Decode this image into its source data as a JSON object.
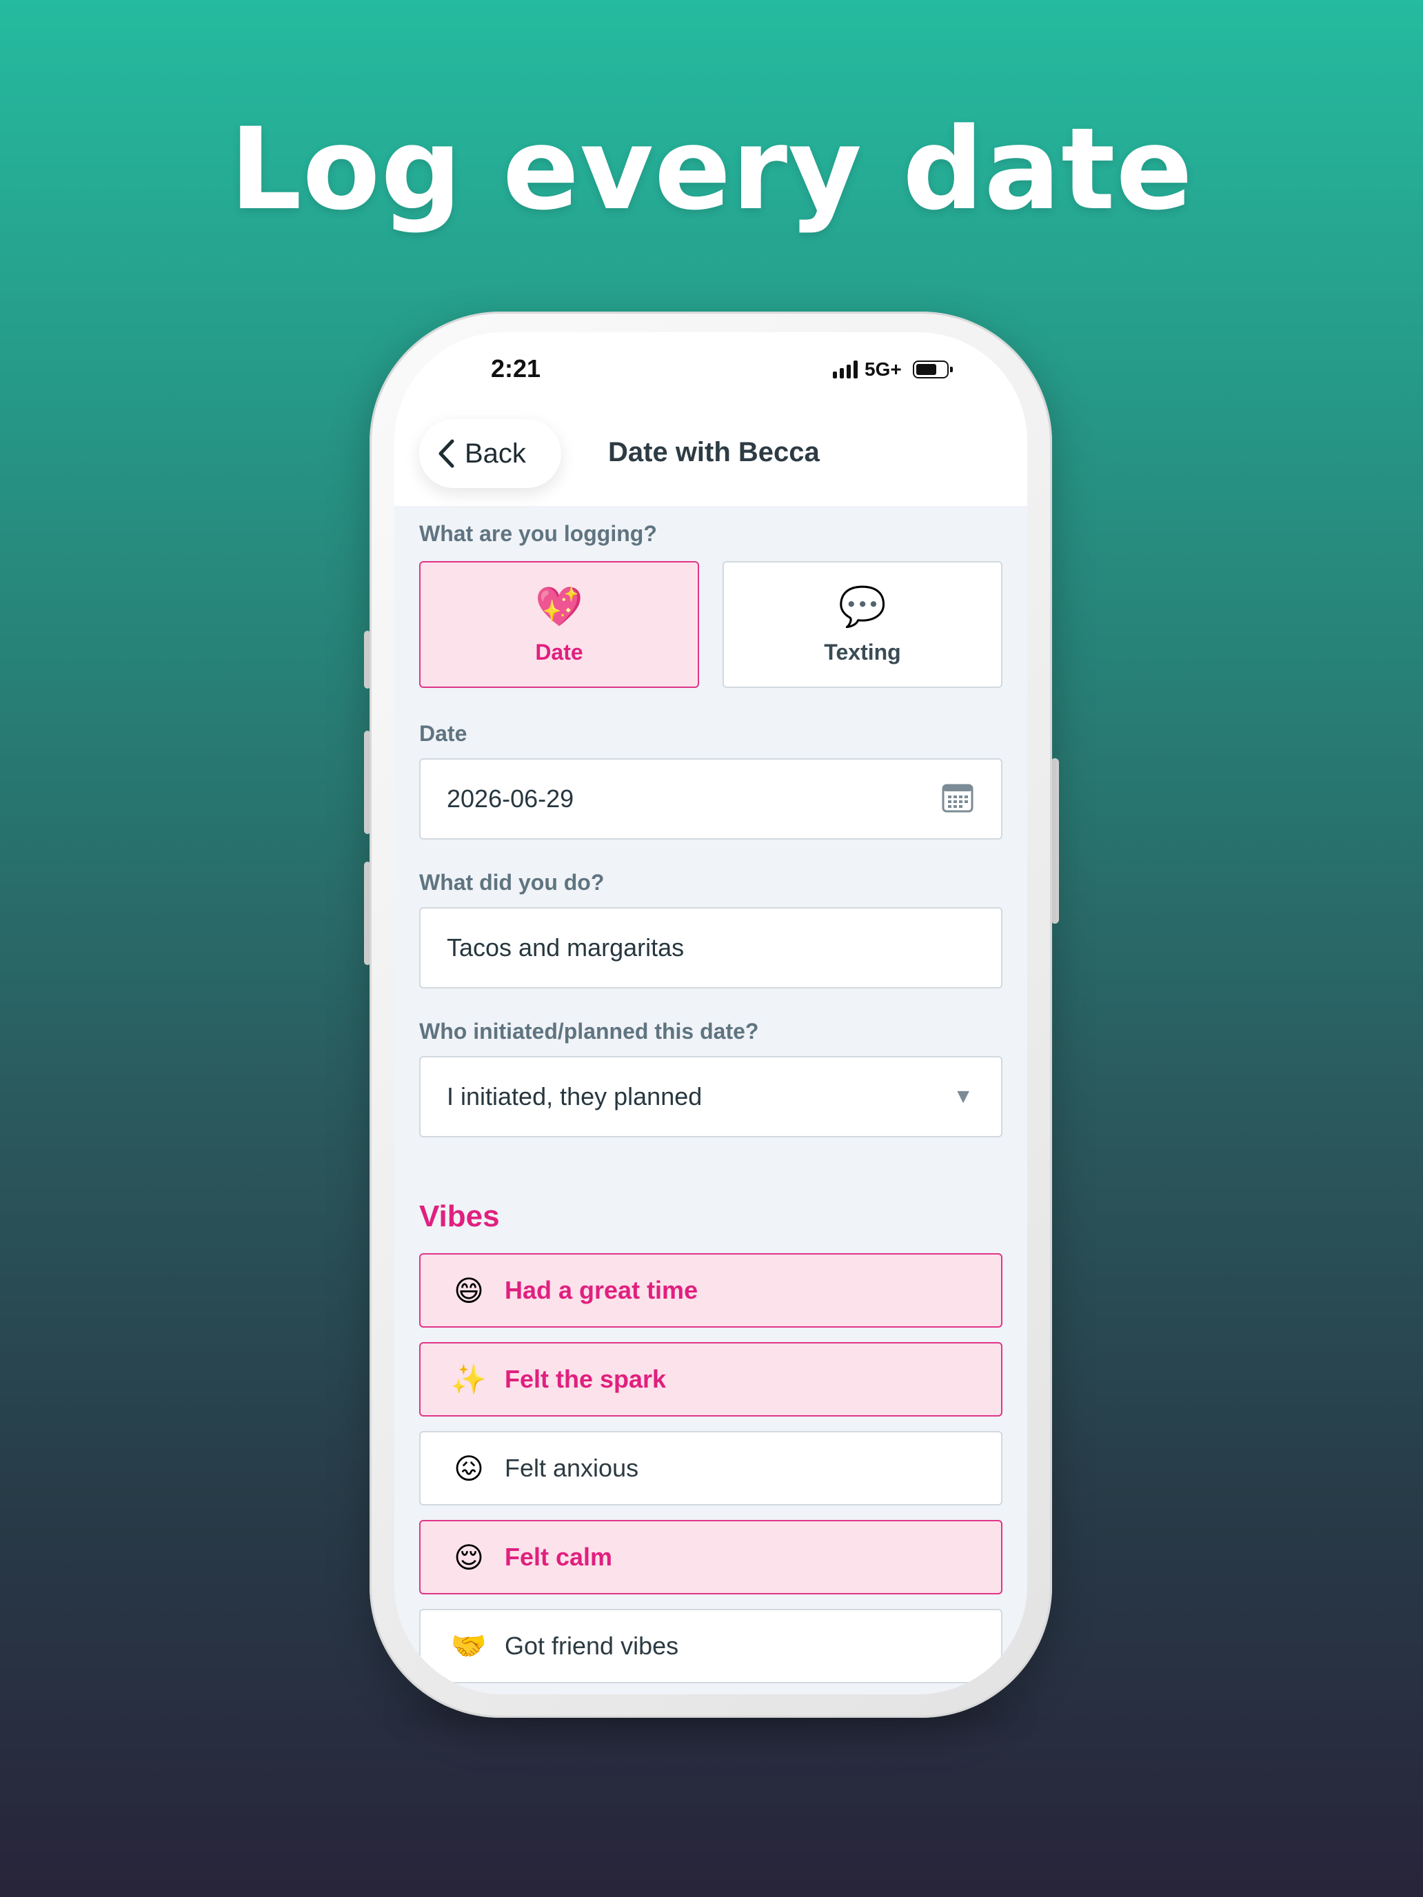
{
  "headline": "Log every date",
  "status_bar": {
    "time": "2:21",
    "network": "5G+"
  },
  "nav": {
    "back_label": "Back",
    "title": "Date with Becca"
  },
  "logging": {
    "question": "What are you logging?",
    "options": [
      {
        "emoji": "💖",
        "label": "Date",
        "selected": true
      },
      {
        "emoji": "💬",
        "label": "Texting",
        "selected": false
      }
    ]
  },
  "date_field": {
    "label": "Date",
    "value": "2026-06-29"
  },
  "activity_field": {
    "label": "What did you do?",
    "value": "Tacos and margaritas"
  },
  "initiator_field": {
    "label": "Who initiated/planned this date?",
    "value": "I initiated, they planned",
    "arrow": "▼"
  },
  "vibes": {
    "title": "Vibes",
    "items": [
      {
        "emoji": "😄",
        "label": "Had a great time",
        "selected": true
      },
      {
        "emoji": "✨",
        "label": "Felt the spark",
        "selected": true
      },
      {
        "emoji": "😖",
        "label": "Felt anxious",
        "selected": false
      },
      {
        "emoji": "😌",
        "label": "Felt calm",
        "selected": true
      },
      {
        "emoji": "🤝",
        "label": "Got friend vibes",
        "selected": false
      }
    ]
  },
  "colors": {
    "accent": "#e0207f",
    "selected_bg": "#fce2ea",
    "gradient_top": "#25bba0",
    "gradient_bottom": "#28243a"
  }
}
